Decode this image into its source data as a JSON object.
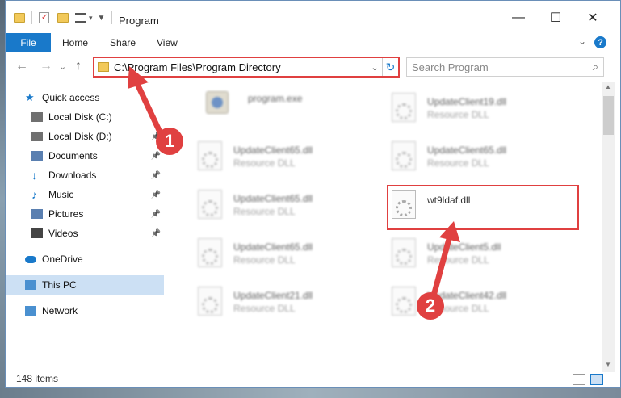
{
  "window": {
    "title": "Program",
    "minimize": "—",
    "maximize": "☐",
    "close": "✕"
  },
  "ribbon": {
    "file": "File",
    "home": "Home",
    "share": "Share",
    "view": "View",
    "help": "?",
    "expand": "⌄"
  },
  "nav": {
    "back": "←",
    "forward": "→",
    "recent": "⌄",
    "up": "↑",
    "address": "C:\\Program Files\\Program Directory",
    "search_placeholder": "Search Program"
  },
  "sidebar": {
    "items": [
      {
        "label": "Quick access",
        "icon": "star-icon",
        "color": "#1979ca"
      },
      {
        "label": "Local Disk (C:)",
        "icon": "drive-icon",
        "color": "#707070"
      },
      {
        "label": "Local Disk (D:)",
        "icon": "drive-icon",
        "color": "#707070"
      },
      {
        "label": "Documents",
        "icon": "documents-icon",
        "color": "#5a7fb0"
      },
      {
        "label": "Downloads",
        "icon": "downloads-icon",
        "color": "#1979ca"
      },
      {
        "label": "Music",
        "icon": "music-icon",
        "color": "#1979ca"
      },
      {
        "label": "Pictures",
        "icon": "pictures-icon",
        "color": "#5a7fb0"
      },
      {
        "label": "Videos",
        "icon": "videos-icon",
        "color": "#444444"
      },
      {
        "label": "OneDrive",
        "icon": "cloud-icon",
        "color": "#1979ca"
      },
      {
        "label": "This PC",
        "icon": "computer-icon",
        "color": "#4a90d0"
      },
      {
        "label": "Network",
        "icon": "network-icon",
        "color": "#4a90d0"
      }
    ]
  },
  "files": [
    {
      "name": "program.exe",
      "type": ""
    },
    {
      "name": "UpdateClient19.dll",
      "type": "Resource DLL"
    },
    {
      "name": "UpdateClient65.dll",
      "type": "Resource DLL"
    },
    {
      "name": "UpdateClient65.dll",
      "type": "Resource DLL"
    },
    {
      "name": "UpdateClient65.dll",
      "type": "Resource DLL"
    },
    {
      "name": "wt9ldaf.dll",
      "type": ""
    },
    {
      "name": "UpdateClient65.dll",
      "type": "Resource DLL"
    },
    {
      "name": "UpdateClient5.dll",
      "type": "Resource DLL"
    },
    {
      "name": "UpdateClient21.dll",
      "type": "Resource DLL"
    },
    {
      "name": "UpdateClient42.dll",
      "type": "Resource DLL"
    }
  ],
  "status": {
    "count": "148 items"
  },
  "annotations": {
    "step1": "1",
    "step2": "2",
    "color": "#e04040"
  }
}
